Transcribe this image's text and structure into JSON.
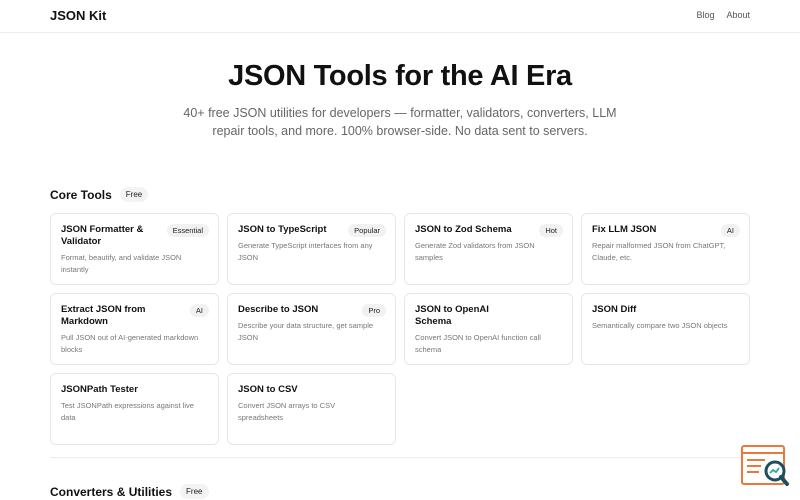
{
  "header": {
    "brand": "JSON Kit",
    "nav": [
      {
        "label": "Blog"
      },
      {
        "label": "About"
      }
    ]
  },
  "hero": {
    "title": "JSON Tools for the AI Era",
    "subtitle": "40+ free JSON utilities for developers — formatter, validators, converters, LLM repair tools, and more. 100% browser-side. No data sent to servers."
  },
  "sections": [
    {
      "title": "Core Tools",
      "badge": "Free",
      "tools": [
        {
          "title": "JSON Formatter & Validator",
          "badge": "Essential",
          "desc": "Format, beautify, and validate JSON instantly"
        },
        {
          "title": "JSON to TypeScript",
          "badge": "Popular",
          "desc": "Generate TypeScript interfaces from any JSON"
        },
        {
          "title": "JSON to Zod Schema",
          "badge": "Hot",
          "desc": "Generate Zod validators from JSON samples"
        },
        {
          "title": "Fix LLM JSON",
          "badge": "AI",
          "desc": "Repair malformed JSON from ChatGPT, Claude, etc."
        },
        {
          "title": "Extract JSON from Markdown",
          "badge": "AI",
          "desc": "Pull JSON out of AI-generated markdown blocks"
        },
        {
          "title": "Describe to JSON",
          "badge": "Pro",
          "desc": "Describe your data structure, get sample JSON"
        },
        {
          "title": "JSON to OpenAI Schema",
          "badge": "",
          "desc": "Convert JSON to OpenAI function call schema"
        },
        {
          "title": "JSON Diff",
          "badge": "",
          "desc": "Semantically compare two JSON objects"
        },
        {
          "title": "JSONPath Tester",
          "badge": "",
          "desc": "Test JSONPath expressions against live data"
        },
        {
          "title": "JSON to CSV",
          "badge": "",
          "desc": "Convert JSON arrays to CSV spreadsheets"
        }
      ]
    },
    {
      "title": "Converters & Utilities",
      "badge": "Free"
    }
  ],
  "floating_widget": {
    "icon": "search-document-icon",
    "accent": "#e8793a",
    "lens": "#1c4f5e"
  }
}
